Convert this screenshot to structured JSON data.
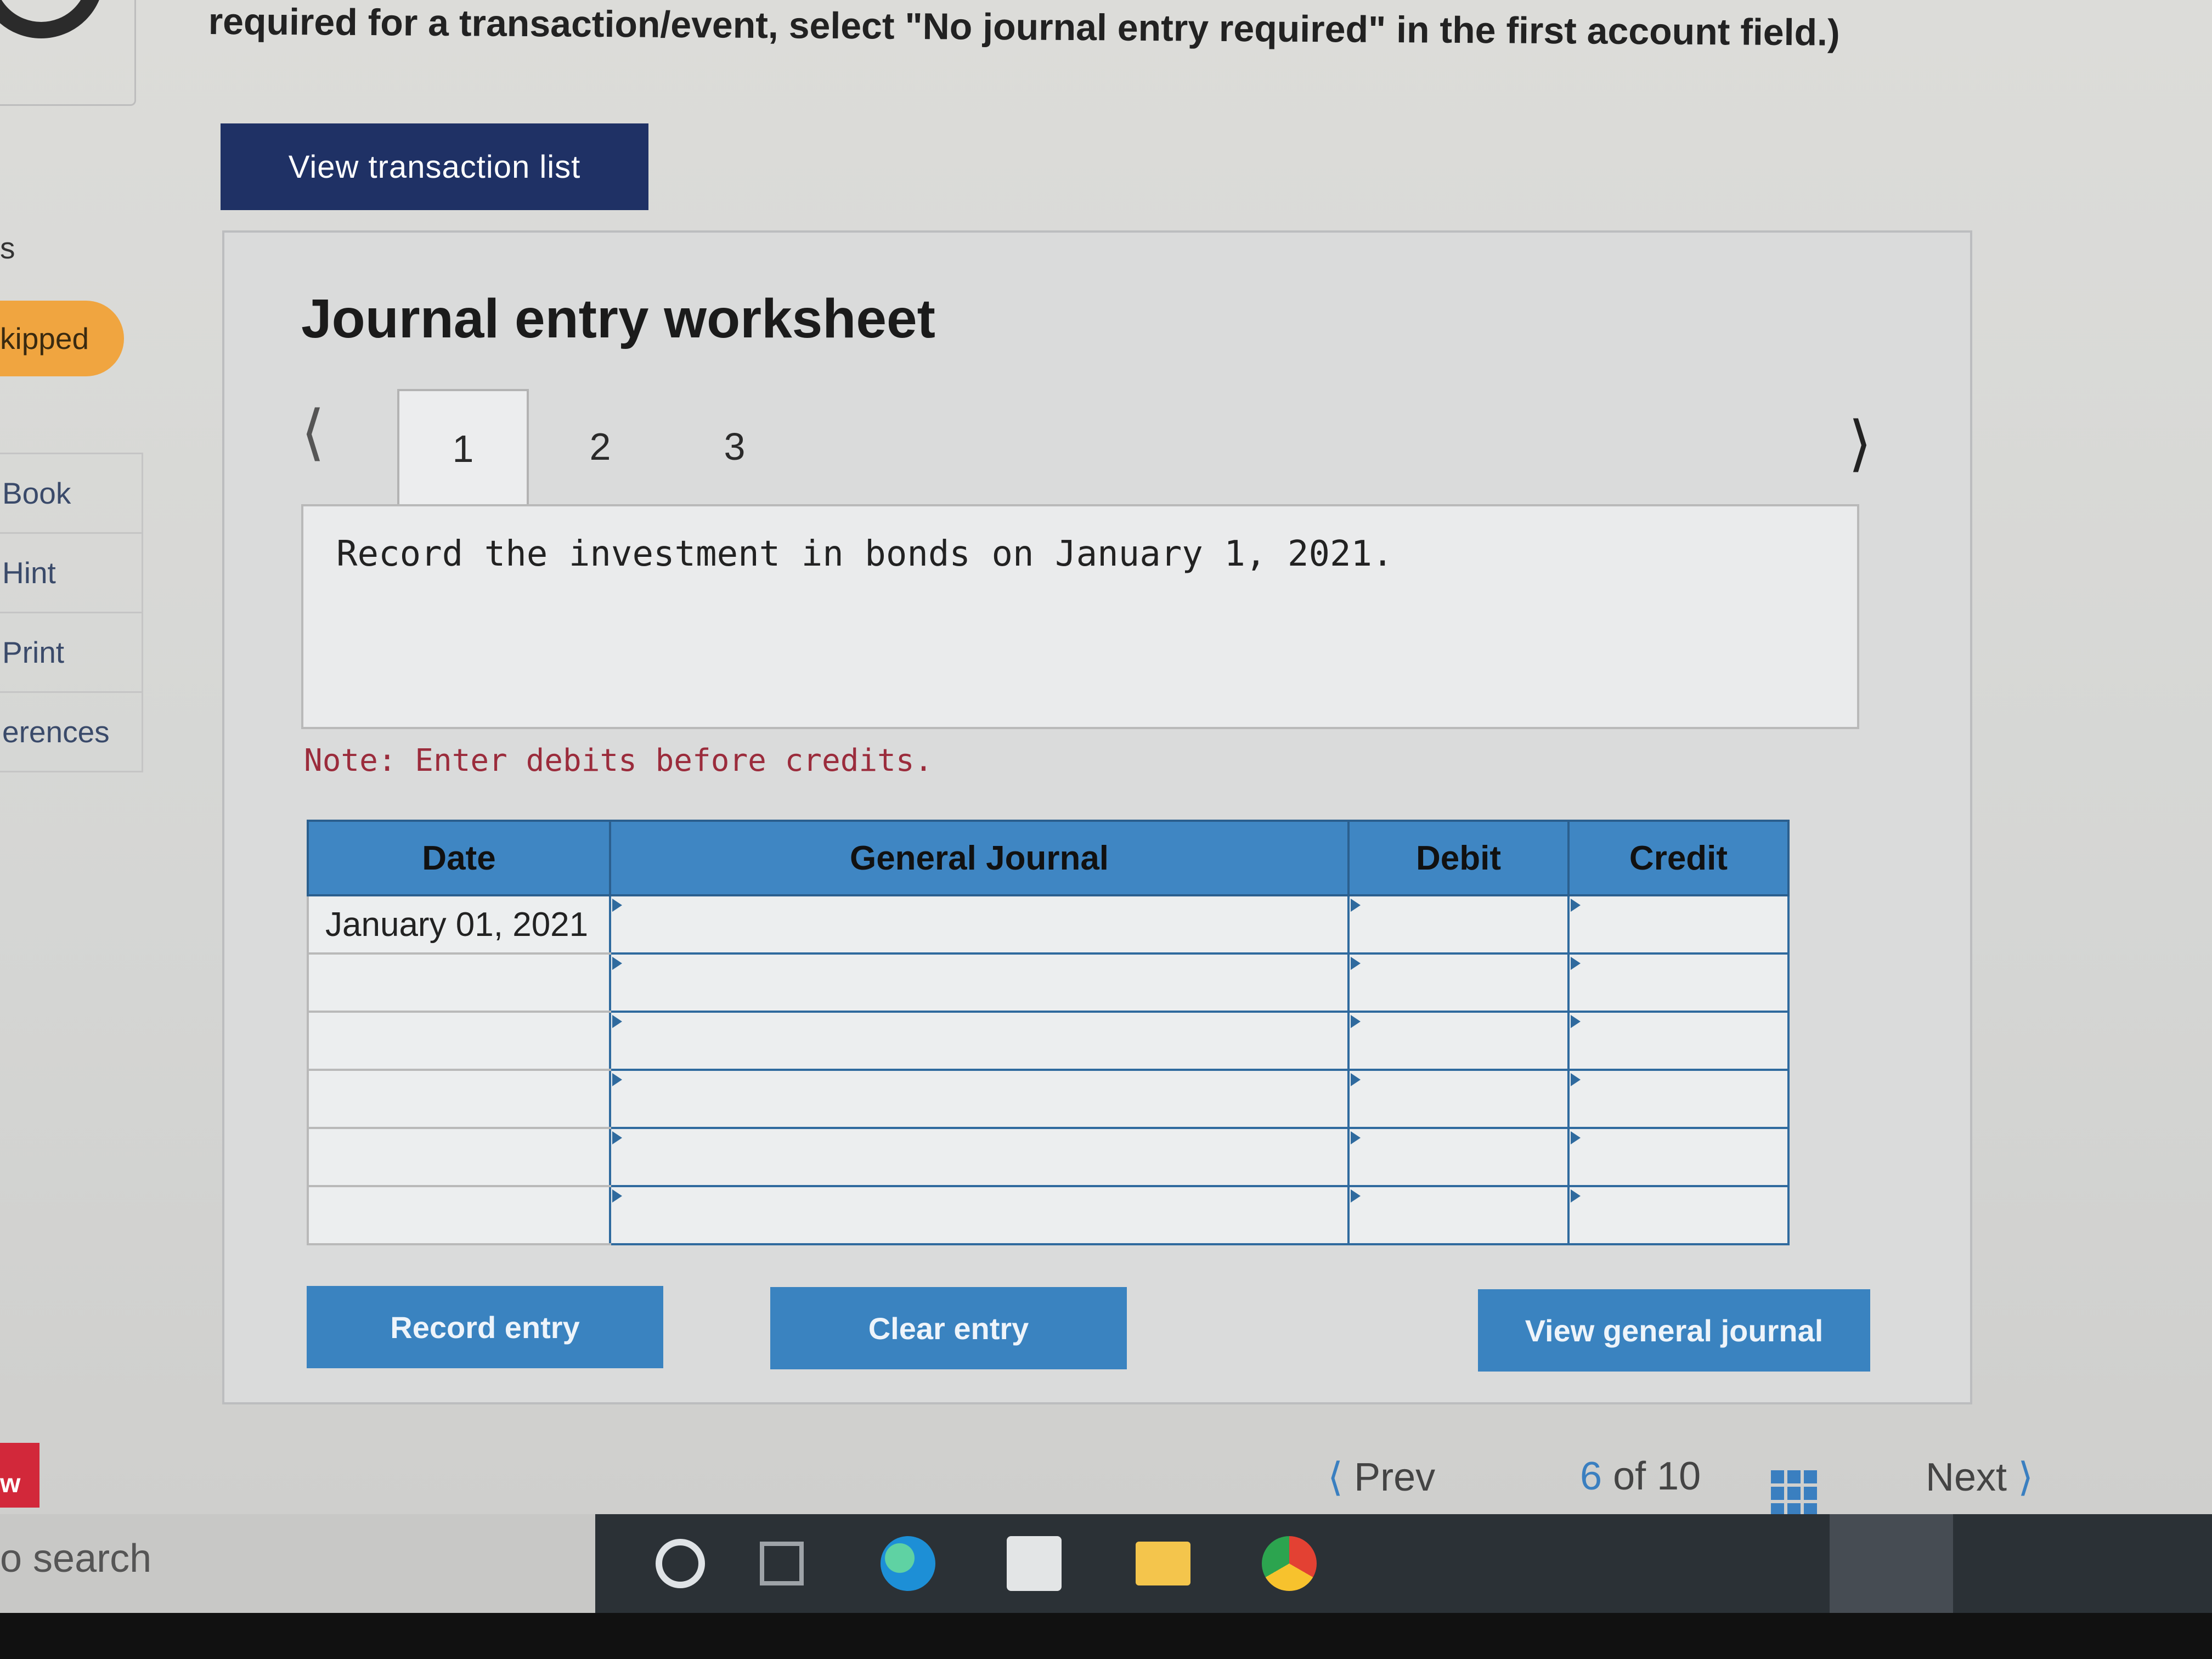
{
  "instruction_text": "required for a transaction/event, select \"No journal entry required\" in the first account field.)",
  "buttons": {
    "view_transaction_list": "View transaction list",
    "record_entry": "Record entry",
    "clear_entry": "Clear entry",
    "view_general_journal": "View general journal"
  },
  "sidebar": {
    "top_fragment": "s",
    "badge": "kipped",
    "items": [
      "Book",
      "Hint",
      "Print",
      "erences"
    ]
  },
  "worksheet": {
    "title": "Journal entry worksheet",
    "tabs": [
      "1",
      "2",
      "3"
    ],
    "active_tab": "1",
    "prompt": "Record the investment in bonds on January 1, 2021.",
    "note": "Note: Enter debits before credits.",
    "table": {
      "headers": [
        "Date",
        "General Journal",
        "Debit",
        "Credit"
      ],
      "rows": [
        [
          "January 01, 2021",
          "",
          "",
          ""
        ],
        [
          "",
          "",
          "",
          ""
        ],
        [
          "",
          "",
          "",
          ""
        ],
        [
          "",
          "",
          "",
          ""
        ],
        [
          "",
          "",
          "",
          ""
        ],
        [
          "",
          "",
          "",
          ""
        ]
      ]
    }
  },
  "pager": {
    "prev": "Prev",
    "current": "6",
    "of": "of",
    "total": "10",
    "next": "Next"
  },
  "red_tab_text": "w",
  "taskbar": {
    "search_fragment": "o search",
    "icons": [
      "cortana-icon",
      "task-view-icon",
      "edge-icon",
      "store-icon",
      "file-explorer-icon",
      "chrome-icon"
    ]
  },
  "colors": {
    "dark_button": "#1f3165",
    "table_header": "#3f86c3",
    "action_button": "#3a83c0",
    "skipped_badge": "#f0a540",
    "note_text": "#9b2c3c"
  }
}
